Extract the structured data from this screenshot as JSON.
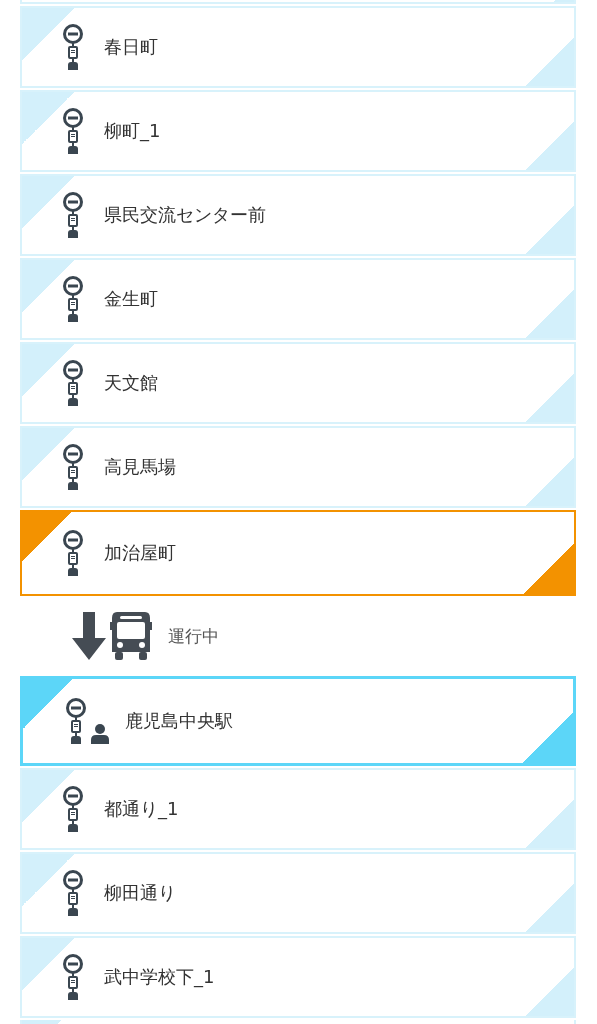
{
  "stops_before": [
    {
      "name": "春日町",
      "kind": "normal"
    },
    {
      "name": "柳町_1",
      "kind": "normal"
    },
    {
      "name": "県民交流センター前",
      "kind": "normal"
    },
    {
      "name": "金生町",
      "kind": "normal"
    },
    {
      "name": "天文館",
      "kind": "normal"
    },
    {
      "name": "高見馬場",
      "kind": "normal"
    },
    {
      "name": "加治屋町",
      "kind": "current"
    }
  ],
  "bus_status": {
    "label": "運行中"
  },
  "stops_after": [
    {
      "name": "鹿児島中央駅",
      "kind": "boarding"
    },
    {
      "name": "都通り_1",
      "kind": "normal"
    },
    {
      "name": "柳田通り",
      "kind": "normal"
    },
    {
      "name": "武中学校下_1",
      "kind": "normal"
    }
  ]
}
